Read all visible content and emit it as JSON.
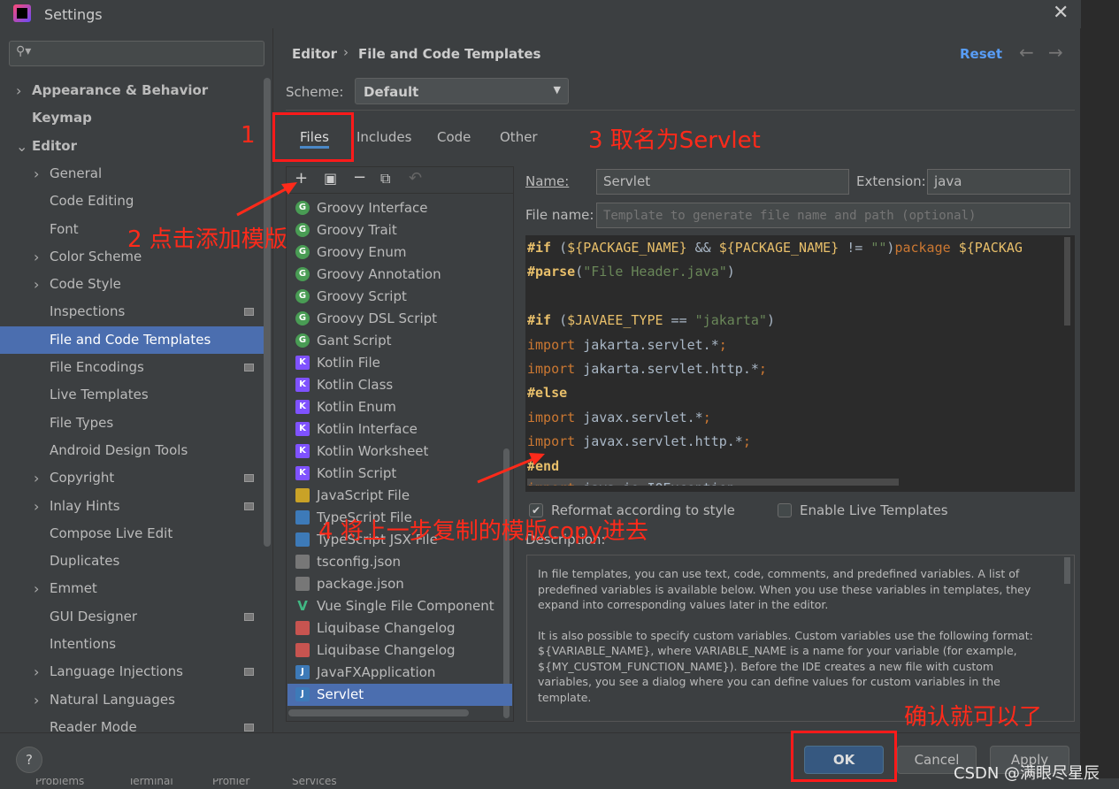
{
  "window": {
    "title": "Settings"
  },
  "search": {
    "placeholder": ""
  },
  "sidebar": {
    "items": [
      {
        "label": "Appearance & Behavior",
        "level": 0,
        "expand": "collapsed"
      },
      {
        "label": "Keymap",
        "level": 0
      },
      {
        "label": "Editor",
        "level": 0,
        "expand": "expanded"
      },
      {
        "label": "General",
        "level": 1,
        "expand": "collapsed"
      },
      {
        "label": "Code Editing",
        "level": 1
      },
      {
        "label": "Font",
        "level": 1
      },
      {
        "label": "Color Scheme",
        "level": 1,
        "expand": "collapsed"
      },
      {
        "label": "Code Style",
        "level": 1,
        "expand": "collapsed"
      },
      {
        "label": "Inspections",
        "level": 1,
        "project": true
      },
      {
        "label": "File and Code Templates",
        "level": 1,
        "selected": true
      },
      {
        "label": "File Encodings",
        "level": 1,
        "project": true
      },
      {
        "label": "Live Templates",
        "level": 1
      },
      {
        "label": "File Types",
        "level": 1
      },
      {
        "label": "Android Design Tools",
        "level": 1
      },
      {
        "label": "Copyright",
        "level": 1,
        "expand": "collapsed",
        "project": true
      },
      {
        "label": "Inlay Hints",
        "level": 1,
        "expand": "collapsed",
        "project": true
      },
      {
        "label": "Compose Live Edit",
        "level": 1
      },
      {
        "label": "Duplicates",
        "level": 1
      },
      {
        "label": "Emmet",
        "level": 1,
        "expand": "collapsed"
      },
      {
        "label": "GUI Designer",
        "level": 1,
        "project": true
      },
      {
        "label": "Intentions",
        "level": 1
      },
      {
        "label": "Language Injections",
        "level": 1,
        "expand": "collapsed",
        "project": true
      },
      {
        "label": "Natural Languages",
        "level": 1,
        "expand": "collapsed"
      },
      {
        "label": "Reader Mode",
        "level": 1,
        "project": true
      }
    ]
  },
  "header": {
    "breadcrumb": [
      "Editor",
      "File and Code Templates"
    ],
    "reset": "Reset"
  },
  "scheme": {
    "label": "Scheme:",
    "value": "Default"
  },
  "tabs": [
    {
      "label": "Files",
      "active": true
    },
    {
      "label": "Includes"
    },
    {
      "label": "Code"
    },
    {
      "label": "Other"
    }
  ],
  "templates": [
    {
      "label": "Groovy Interface",
      "icon": "G",
      "color": "#499c54"
    },
    {
      "label": "Groovy Trait",
      "icon": "G",
      "color": "#499c54"
    },
    {
      "label": "Groovy Enum",
      "icon": "G",
      "color": "#499c54"
    },
    {
      "label": "Groovy Annotation",
      "icon": "G",
      "color": "#499c54"
    },
    {
      "label": "Groovy Script",
      "icon": "G",
      "color": "#499c54"
    },
    {
      "label": "Groovy DSL Script",
      "icon": "G",
      "color": "#499c54"
    },
    {
      "label": "Gant Script",
      "icon": "G",
      "color": "#499c54"
    },
    {
      "label": "Kotlin File",
      "icon": "K",
      "color": "#7f52ff"
    },
    {
      "label": "Kotlin Class",
      "icon": "K",
      "color": "#7f52ff"
    },
    {
      "label": "Kotlin Enum",
      "icon": "K",
      "color": "#7f52ff"
    },
    {
      "label": "Kotlin Interface",
      "icon": "K",
      "color": "#7f52ff"
    },
    {
      "label": "Kotlin Worksheet",
      "icon": "K",
      "color": "#7f52ff"
    },
    {
      "label": "Kotlin Script",
      "icon": "K",
      "color": "#7f52ff"
    },
    {
      "label": "JavaScript File",
      "icon": "JS",
      "color": "#c9a227"
    },
    {
      "label": "TypeScript File",
      "icon": "TS",
      "color": "#3d7ab8"
    },
    {
      "label": "TypeScript JSX File",
      "icon": "TSX",
      "color": "#3d7ab8"
    },
    {
      "label": "tsconfig.json",
      "icon": "{}",
      "color": "#777"
    },
    {
      "label": "package.json",
      "icon": "{}",
      "color": "#777"
    },
    {
      "label": "Vue Single File Component",
      "icon": "V",
      "color": "#41b883"
    },
    {
      "label": "Liquibase Changelog",
      "icon": "<>",
      "color": "#c75450"
    },
    {
      "label": "Liquibase Changelog",
      "icon": "YML",
      "color": "#c75450"
    },
    {
      "label": "JavaFXApplication",
      "icon": "J",
      "color": "#3d7ab8"
    },
    {
      "label": "Servlet",
      "icon": "J",
      "color": "#3d7ab8",
      "selected": true
    }
  ],
  "form": {
    "name_label": "Name:",
    "name_value": "Servlet",
    "ext_label": "Extension:",
    "ext_value": "java",
    "filename_label": "File name:",
    "filename_placeholder": "Template to generate file name and path (optional)"
  },
  "code_lines": [
    [
      [
        "dir",
        "#if "
      ],
      [
        "pl",
        "("
      ],
      [
        "var",
        "${PACKAGE_NAME}"
      ],
      [
        "pl",
        " && "
      ],
      [
        "var",
        "${PACKAGE_NAME}"
      ],
      [
        "pl",
        " != "
      ],
      [
        "str",
        "\"\""
      ],
      [
        "pl",
        ")"
      ],
      [
        "kw",
        "package "
      ],
      [
        "var",
        "${PACKAG"
      ]
    ],
    [
      [
        "dir",
        "#parse"
      ],
      [
        "pl",
        "("
      ],
      [
        "str",
        "\"File Header.java\""
      ],
      [
        "pl",
        ")"
      ]
    ],
    [],
    [
      [
        "dir",
        "#if "
      ],
      [
        "pl",
        "("
      ],
      [
        "var",
        "$JAVAEE_TYPE"
      ],
      [
        "pl",
        " == "
      ],
      [
        "str",
        "\"jakarta\""
      ],
      [
        "pl",
        ")"
      ]
    ],
    [
      [
        "kw",
        "import "
      ],
      [
        "pl",
        "jakarta.servlet.*"
      ],
      [
        "kw",
        ";"
      ]
    ],
    [
      [
        "kw",
        "import "
      ],
      [
        "pl",
        "jakarta.servlet.http.*"
      ],
      [
        "kw",
        ";"
      ]
    ],
    [
      [
        "dir",
        "#else"
      ]
    ],
    [
      [
        "kw",
        "import "
      ],
      [
        "pl",
        "javax.servlet.*"
      ],
      [
        "kw",
        ";"
      ]
    ],
    [
      [
        "kw",
        "import "
      ],
      [
        "pl",
        "javax.servlet.http.*"
      ],
      [
        "kw",
        ";"
      ]
    ],
    [
      [
        "dir",
        "#end"
      ]
    ],
    [
      [
        "kw",
        "import "
      ],
      [
        "pl",
        "java.io.IOException;"
      ]
    ]
  ],
  "options": {
    "reformat": {
      "label": "Reformat according to style",
      "checked": true
    },
    "live": {
      "label": "Enable Live Templates",
      "checked": false
    }
  },
  "description": {
    "label": "Description:",
    "p1": "In file templates, you can use text, code, comments, and predefined variables. A list of predefined variables is available below. When you use these variables in templates, they expand into corresponding values later in the editor.",
    "p2": "It is also possible to specify custom variables. Custom variables use the following format: ${VARIABLE_NAME}, where VARIABLE_NAME is a name for your variable (for example, ${MY_CUSTOM_FUNCTION_NAME}). Before the IDE creates a new file with custom variables, you see a dialog where you can define values for custom variables in the template."
  },
  "buttons": {
    "help": "?",
    "ok": "OK",
    "cancel": "Cancel",
    "apply": "Apply"
  },
  "bottom_tools": [
    "Problems",
    "Terminal",
    "Profiler",
    "Services"
  ],
  "annotations": {
    "n1": "1",
    "n2": "2 点击添加模版",
    "n3": "3 取名为Servlet",
    "n4": "4 将上一步复制的模版copy进去",
    "n5": "确认就可以了",
    "color": "#ff2a1a"
  },
  "watermark": "CSDN @满眼尽星辰",
  "colors": {
    "accent": "#4b6eaf",
    "ok_button": "#365880",
    "link": "#589df6"
  }
}
